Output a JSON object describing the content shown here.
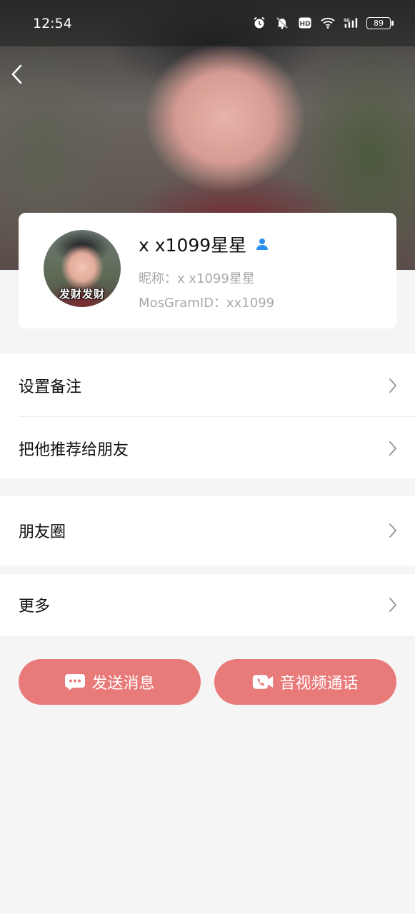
{
  "status_bar": {
    "time": "12:54",
    "battery": "89",
    "icons": [
      "alarm-icon",
      "mute-bell-icon",
      "hd-icon",
      "wifi-icon",
      "5g-signal-icon",
      "battery-icon"
    ]
  },
  "header": {
    "back_icon": "chevron-left-icon"
  },
  "profile": {
    "name": "x x1099星星",
    "badge_icon": "user-badge-icon",
    "nickname": "昵称：x x1099星星",
    "mosgram_id": "MosGramID：xx1099",
    "avatar_caption": "发财发财"
  },
  "menu_groups": [
    {
      "items": [
        {
          "label": "设置备注"
        },
        {
          "label": "把他推荐给朋友"
        }
      ]
    },
    {
      "items": [
        {
          "label": "朋友圈"
        }
      ]
    },
    {
      "items": [
        {
          "label": "更多"
        }
      ]
    }
  ],
  "actions": {
    "send_message": "发送消息",
    "av_call": "音视频通话"
  },
  "colors": {
    "accent": "#e97a7a",
    "badge": "#2a8ff0",
    "secondary_text": "#a8a8a8",
    "background": "#f5f5f5"
  }
}
